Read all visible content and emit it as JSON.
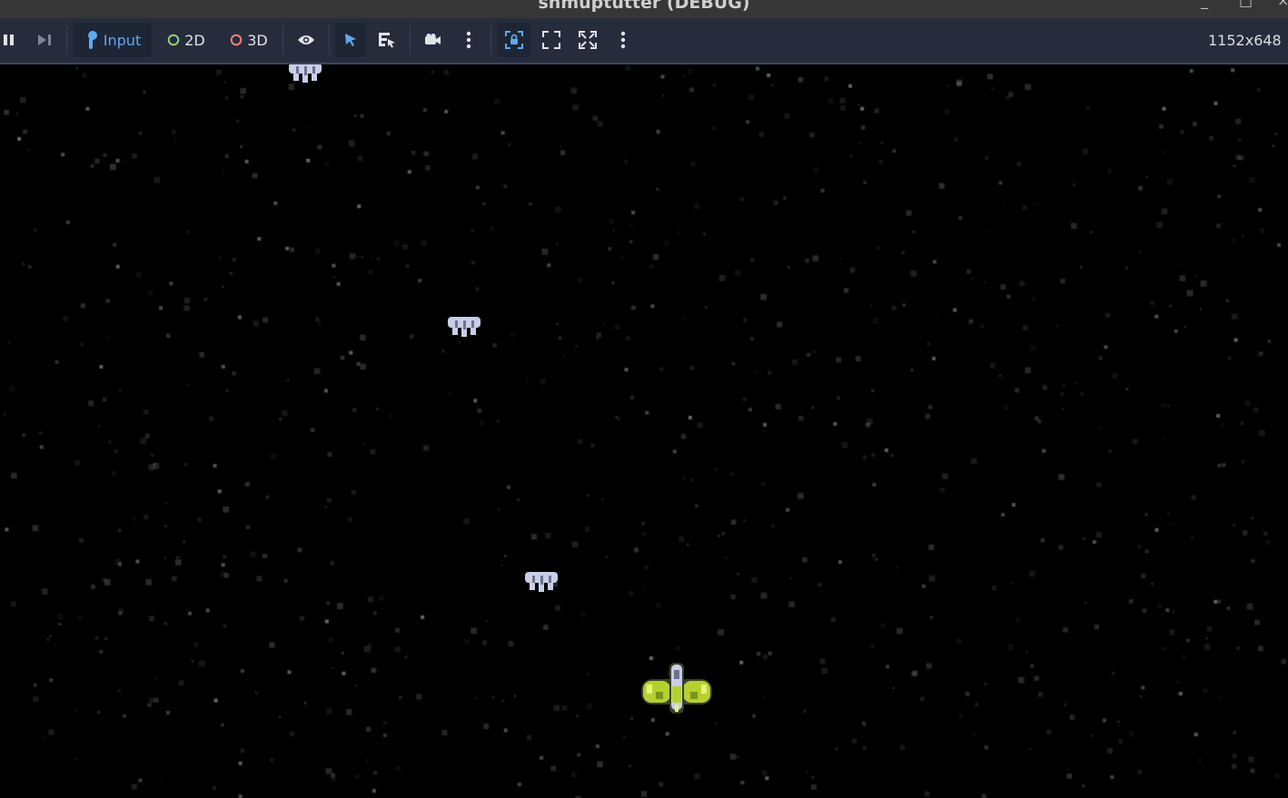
{
  "window": {
    "title": "shmuptutter (DEBUG)"
  },
  "toolbar": {
    "pause_icon": "pause-icon",
    "step_icon": "next-frame-icon",
    "input_label": "Input",
    "mode_2d_label": "2D",
    "mode_3d_label": "3D",
    "visibility_icon": "eye-icon",
    "select_icon": "arrow-cursor-icon",
    "list_select_icon": "list-select-icon",
    "camera_icon": "camera-icon",
    "more_icon": "kebab-menu-icon",
    "embed_icon": "lock-frame-icon",
    "keep_aspect_icon": "expand-corners-icon",
    "fullscreen_icon": "fullscreen-icon",
    "more2_icon": "kebab-menu-icon",
    "resolution": "1152x648"
  },
  "colors": {
    "toolbar_bg": "#262c3b",
    "accent": "#5fa8ee",
    "mode_2d": "#8fd07d",
    "mode_3d": "#fc7f7f",
    "player_ship": "#b5d12f",
    "enemy_ship": "#c9cde6"
  },
  "game": {
    "enemies": [
      "enemy-ship",
      "enemy-ship",
      "enemy-ship"
    ],
    "player": "player-ship"
  }
}
